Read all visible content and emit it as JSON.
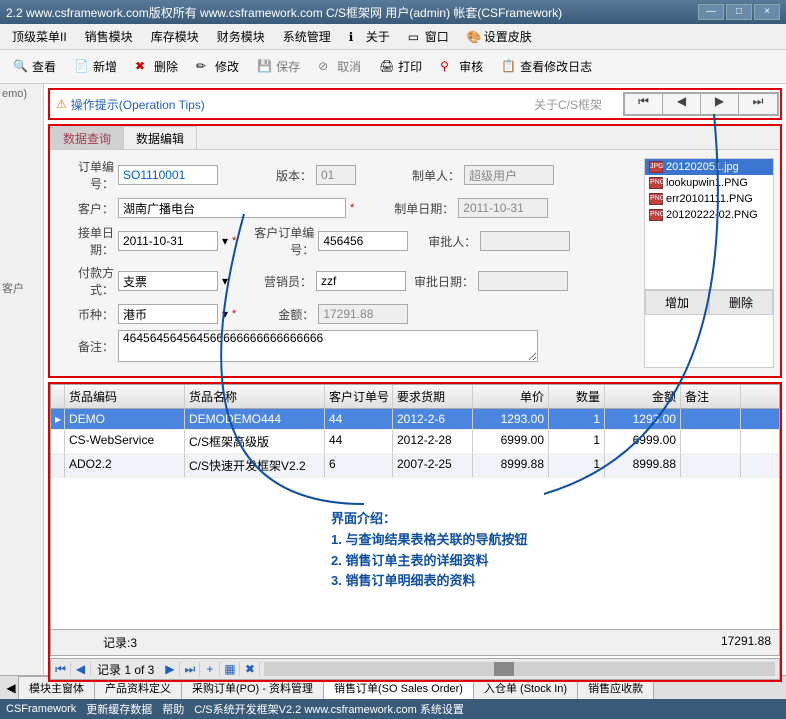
{
  "titlebar": "2.2 www.csframework.com版权所有 www.csframework.com C/S框架网 用户(admin) 帐套(CSFramework)",
  "menubar": [
    "顶级菜单II",
    "销售模块",
    "库存模块",
    "财务模块",
    "系统管理",
    "关于",
    "窗口",
    "设置皮肤"
  ],
  "toolbar": {
    "view": "查看",
    "add": "新增",
    "delete": "删除",
    "edit": "修改",
    "save": "保存",
    "cancel": "取消",
    "print": "打印",
    "approve": "审核",
    "log": "查看修改日志"
  },
  "left_panel": [
    "emo)",
    "客户"
  ],
  "tips": {
    "label": "操作提示(Operation Tips)",
    "center": "关于C/S框架"
  },
  "tabs": {
    "query": "数据查询",
    "edit": "数据编辑"
  },
  "form": {
    "order_no_label": "订单编号：",
    "order_no": "SO1110001",
    "version_label": "版本：",
    "version": "01",
    "creator_label": "制单人：",
    "creator": "超级用户",
    "customer_label": "客户：",
    "customer": "湖南广播电台",
    "create_date_label": "制单日期：",
    "create_date": "2011-10-31",
    "recv_date_label": "接单日期：",
    "recv_date": "2011-10-31",
    "cust_order_label": "客户订单编号：",
    "cust_order": "456456",
    "approver_label": "审批人：",
    "approver": "",
    "pay_label": "付款方式：",
    "pay": "支票",
    "sales_label": "营销员：",
    "sales": "zzf",
    "approve_date_label": "审批日期：",
    "approve_date": "",
    "currency_label": "币种：",
    "currency": "港币",
    "amount_label": "金额：",
    "amount": "17291.88",
    "remark_label": "备注：",
    "remark": "464564564564566666666666666666"
  },
  "files": {
    "items": [
      "201202051.jpg",
      "lookupwin1.PNG",
      "err20101111.PNG",
      "20120222-02.PNG"
    ],
    "add": "增加",
    "del": "删除"
  },
  "grid": {
    "headers": [
      "货品编码",
      "货品名称",
      "客户订单号",
      "要求货期",
      "单价",
      "数量",
      "金额",
      "备注"
    ],
    "rows": [
      {
        "code": "DEMO",
        "name": "DEMODEMO444",
        "co": "44",
        "date": "2012-2-6",
        "price": "1293.00",
        "qty": "1",
        "amt": "1293.00",
        "rmk": ""
      },
      {
        "code": "CS-WebService",
        "name": "C/S框架高级版",
        "co": "44",
        "date": "2012-2-28",
        "price": "6999.00",
        "qty": "1",
        "amt": "6999.00",
        "rmk": ""
      },
      {
        "code": "ADO2.2",
        "name": "C/S快速开发框架V2.2",
        "co": "6",
        "date": "2007-2-25",
        "price": "8999.88",
        "qty": "1",
        "amt": "8999.88",
        "rmk": ""
      }
    ],
    "footer_count": "记录:3",
    "footer_total": "17291.88"
  },
  "intro": {
    "title": "界面介绍：",
    "l1": "1. 与查询结果表格关联的导航按钮",
    "l2": "2. 销售订单主表的详细资料",
    "l3": "3. 销售订单明细表的资料"
  },
  "pager": {
    "text": "记录 1 of 3"
  },
  "bottom_tabs": [
    "模块主窗体",
    "产品资料定义",
    "采购订单(PO) - 资料管理",
    "销售订单(SO Sales Order)",
    "入仓单 (Stock In)",
    "销售应收款"
  ],
  "statusbar": [
    "CSFramework",
    "更新缓存数据",
    "帮助",
    "C/S系统开发框架V2.2 www.csframework.com 系统设置"
  ]
}
